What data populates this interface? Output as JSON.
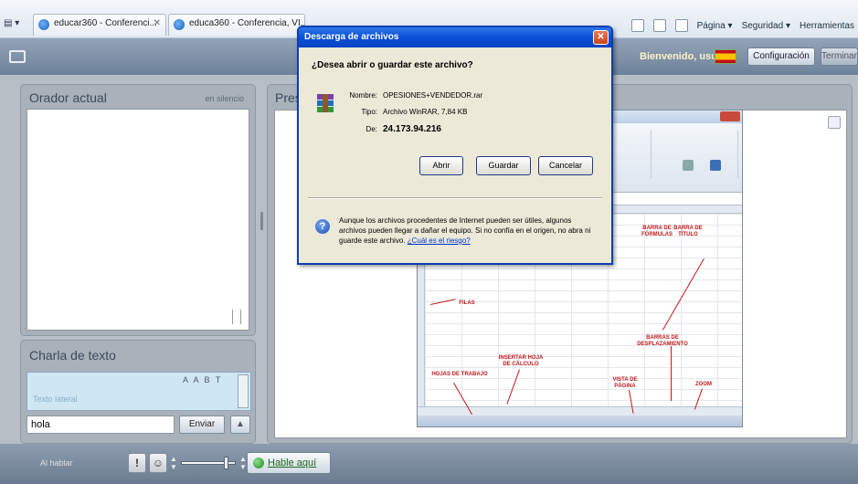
{
  "browser": {
    "quick_tabs": "▤ ▾",
    "tabs": [
      {
        "label": "educar360 - Conferenci..."
      },
      {
        "label": "educa360 - Conferencia, VI..."
      }
    ],
    "commands": [
      "Página ▾",
      "Seguridad ▾",
      "Herramientas"
    ]
  },
  "app": {
    "welcome": "Bienvenido, usuario",
    "config_label": "Configuración",
    "close_label": "Terminar"
  },
  "speaker": {
    "title": "Orador actual",
    "status": "en silencio"
  },
  "chat": {
    "title": "Charla de texto",
    "log_text": "Texto lateral",
    "tools": "A A B T",
    "input_value": "hola",
    "send_label": "Enviar"
  },
  "presentation": {
    "title": "Presentación",
    "slide_labels": {
      "barra_formulas": "BARRA DE FÓRMULAS",
      "barra_titulo": "BARRA DE TÍTULO",
      "filas": "FILAS",
      "barras_desplazamiento": "BARRAS DE DESPLAZAMIENTO",
      "insertar_hoja": "INSERTAR HOJA DE CÁLCULO",
      "hojas_trabajo": "HOJAS DE TRABAJO",
      "vista_pagina": "VISTA DE PÁGINA",
      "zoom": "ZOOM"
    }
  },
  "toolbar": {
    "raise_hand_label": "Al hablar",
    "talk_label": "Hable aquí"
  },
  "dialog": {
    "title": "Descarga de archivos",
    "question": "¿Desea abrir o guardar este archivo?",
    "name_label": "Nombre:",
    "name_value": "OPESIONES+VENDEDOR.rar",
    "type_label": "Tipo:",
    "type_value": "Archivo WinRAR, 7,84 KB",
    "from_label": "De:",
    "from_value": "24.173.94.216",
    "open_label": "Abrir",
    "save_label": "Guardar",
    "cancel_label": "Cancelar",
    "warning_text": "Aunque los archivos procedentes de Internet pueden ser útiles, algunos archivos pueden llegar a dañar el equipo. Si no confía en el origen, no abra ni guarde este archivo. ",
    "warning_link": "¿Cuál es el riesgo?"
  },
  "colors": {
    "dialog_title_bg": "#0a4fd7",
    "panel_bg": "#a9b1ba",
    "slide_label": "#c0181b"
  },
  "volume_level": 0.85
}
